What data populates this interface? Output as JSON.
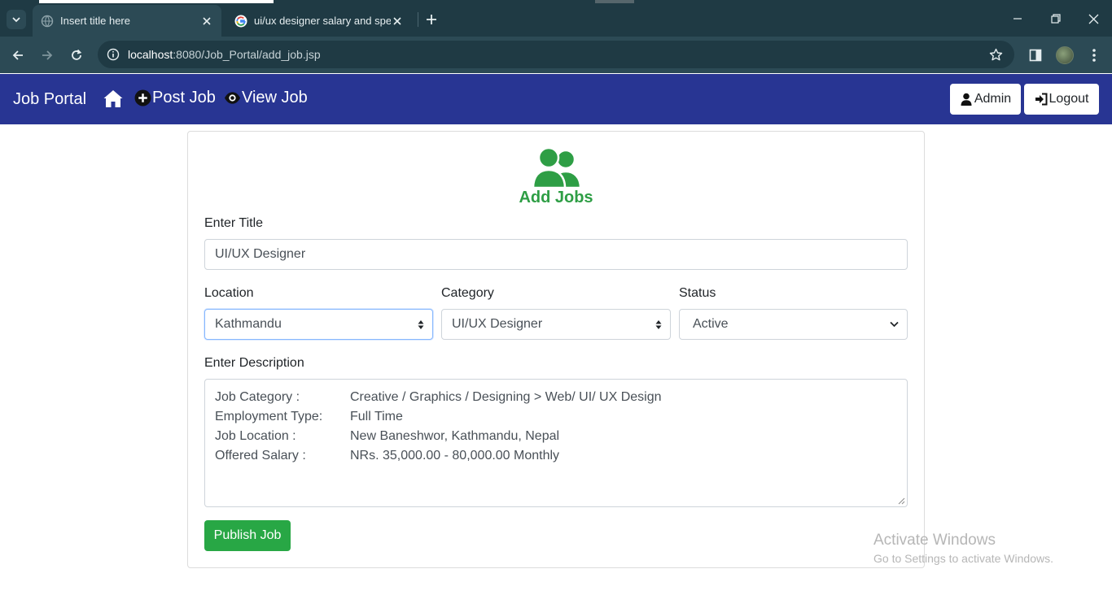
{
  "browser": {
    "tabs": [
      {
        "title": "Insert title here",
        "active": true
      },
      {
        "title": "ui/ux designer salary and specifi",
        "active": false
      }
    ],
    "url_host": "localhost",
    "url_rest": ":8080/Job_Portal/add_job.jsp",
    "theme_color": "#2c4a55"
  },
  "navbar": {
    "brand": "Job Portal",
    "home_icon": "home-icon",
    "links": [
      {
        "label": "Post Job",
        "icon": "plus-circle-icon"
      },
      {
        "label": "View Job",
        "icon": "eye-icon"
      }
    ],
    "buttons": [
      {
        "label": "Admin",
        "icon": "user-icon"
      },
      {
        "label": "Logout",
        "icon": "sign-in-icon"
      }
    ],
    "bg_color": "#283593"
  },
  "form": {
    "heading": "Add Jobs",
    "heading_icon": "users-icon",
    "heading_color": "#2e9e45",
    "title_label": "Enter Title",
    "title_value": "UI/UX Designer",
    "location_label": "Location",
    "location_value": "Kathmandu",
    "category_label": "Category",
    "category_value": "UI/UX Designer",
    "status_label": "Status",
    "status_value": "Active",
    "description_label": "Enter Description",
    "description_lines": [
      {
        "key": "Job Category   :",
        "value": "Creative / Graphics / Designing > Web/ UI/ UX Design"
      },
      {
        "key": "Employment Type:",
        "value": "Full Time"
      },
      {
        "key": "Job Location    :",
        "value": "New Baneshwor, Kathmandu, Nepal"
      },
      {
        "key": "Offered Salary :",
        "value": "NRs. 35,000.00 - 80,000.00 Monthly"
      }
    ],
    "submit_label": "Publish Job",
    "submit_color": "#28a745"
  },
  "watermark": {
    "title": "Activate Windows",
    "subtitle": "Go to Settings to activate Windows."
  }
}
